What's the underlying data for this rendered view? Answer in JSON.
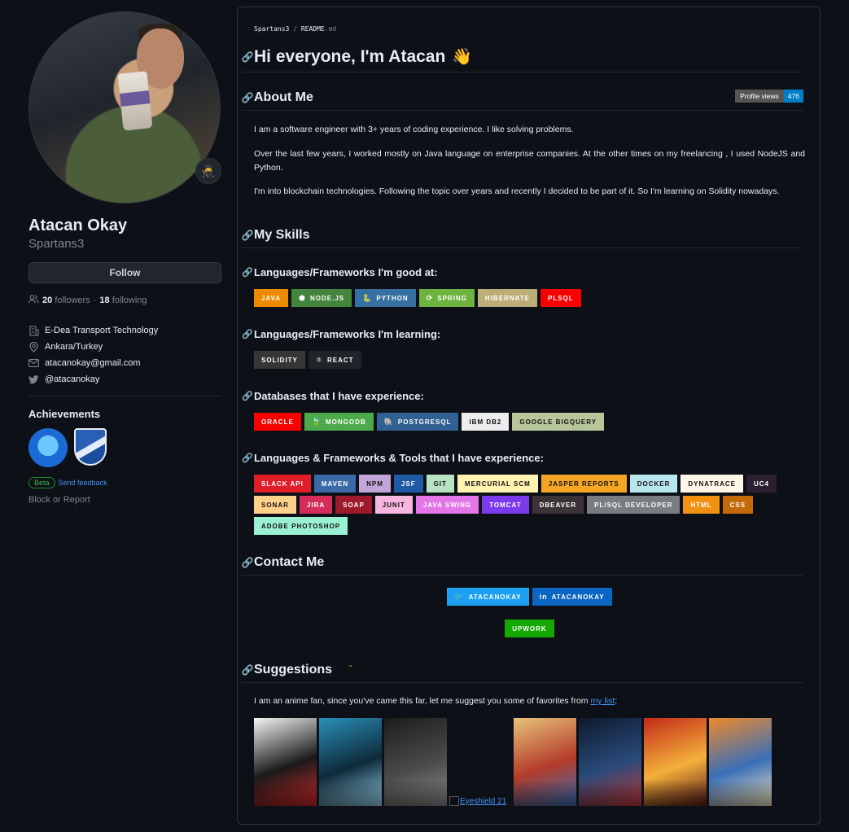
{
  "profile": {
    "fullname": "Atacan Okay",
    "username": "Spartans3",
    "follow_label": "Follow",
    "followers_count": "20",
    "followers_label": "followers",
    "following_count": "18",
    "following_label": "following",
    "separator": "·",
    "company": "E-Dea Transport Technology",
    "location": "Ankara/Turkey",
    "email": "atacanokay@gmail.com",
    "twitter": "@atacanokay",
    "achievements_title": "Achievements",
    "beta_label": "Beta",
    "feedback_label": "Send feedback",
    "block_label": "Block or Report"
  },
  "readme": {
    "breadcrumb_user": "Spartans3",
    "breadcrumb_sep": "/",
    "breadcrumb_file": "README",
    "breadcrumb_ext": ".md",
    "title": "Hi everyone, I'm Atacan",
    "wave": "👋",
    "about_heading": "About Me",
    "profile_views_label": "Profile views",
    "profile_views_count": "476",
    "about_p1": "I am a software engineer with 3+ years of coding experience. I like solving problems.",
    "about_p2": "Over the last few years, I worked mostly on Java language on enterprise companies. At the other times on my freelancing , I used NodeJS and Python.",
    "about_p3": "I'm into blockchain technologies. Following the topic over years and recently I decided to be part of it. So I'm learning on Solidity nowadays.",
    "skills_heading": "My Skills",
    "good_heading": "Languages/Frameworks I'm good at:",
    "learning_heading": "Languages/Frameworks I'm learning:",
    "db_heading": "Databases that I have experience:",
    "tools_heading": "Languages & Frameworks & Tools that I have experience:",
    "contact_heading": "Contact Me",
    "suggestions_heading": "Suggestions",
    "suggestions_text": "I am an anime fan, since you've came this far, let me suggest you some of favorites from",
    "suggestions_link": "my list",
    "suggestions_end": ":",
    "broken_image_alt": "Eyeshield 21"
  },
  "badges": {
    "good": [
      {
        "label": "JAVA",
        "color": "#ED8B00",
        "icon": ""
      },
      {
        "label": "NODE.JS",
        "color": "#43853D",
        "icon": "⬢"
      },
      {
        "label": "PYTHON",
        "color": "#3670A0",
        "icon": "🐍"
      },
      {
        "label": "SPRING",
        "color": "#6DB33F",
        "icon": "⟳"
      },
      {
        "label": "HIBERNATE",
        "color": "#BCAE79",
        "icon": ""
      },
      {
        "label": "PLSQL",
        "color": "#F80000",
        "icon": ""
      }
    ],
    "learning": [
      {
        "label": "SOLIDITY",
        "color": "#363636",
        "icon": ""
      },
      {
        "label": "REACT",
        "color": "#20232A",
        "icon": "⚛"
      }
    ],
    "db": [
      {
        "label": "ORACLE",
        "color": "#F80000",
        "icon": ""
      },
      {
        "label": "MONGODB",
        "color": "#4EA94B",
        "icon": "🍃"
      },
      {
        "label": "POSTGRESQL",
        "color": "#316192",
        "icon": "🐘"
      },
      {
        "label": "IBM DB2",
        "color": "#EDEDED",
        "icon": "",
        "dark": true
      },
      {
        "label": "GOOGLE BIGQUERY",
        "color": "#B8C79A",
        "icon": "",
        "dark": true
      }
    ],
    "tools": [
      {
        "label": "SLACK API",
        "color": "#E01E2A",
        "icon": ""
      },
      {
        "label": "MAVEN",
        "color": "#3A6BA8",
        "icon": ""
      },
      {
        "label": "NPM",
        "color": "#C3A6D9",
        "icon": "",
        "dark": true
      },
      {
        "label": "JSF",
        "color": "#1F5AA6",
        "icon": ""
      },
      {
        "label": "GIT",
        "color": "#B7E3C3",
        "icon": "",
        "dark": true
      },
      {
        "label": "MERCURIAL SCM",
        "color": "#FFF3B0",
        "icon": "",
        "dark": true
      },
      {
        "label": "JASPER REPORTS",
        "color": "#F5A524",
        "icon": "",
        "dark": true
      },
      {
        "label": "DOCKER",
        "color": "#B8E6EE",
        "icon": "",
        "dark": true
      },
      {
        "label": "DYNATRACE",
        "color": "#FFF6E8",
        "icon": "",
        "dark": true
      },
      {
        "label": "UC4",
        "color": "#2A2032",
        "icon": ""
      },
      {
        "label": "SONAR",
        "color": "#FFD08A",
        "icon": "",
        "dark": true
      },
      {
        "label": "JIRA",
        "color": "#D62C5A",
        "icon": ""
      },
      {
        "label": "SOAP",
        "color": "#9C1A2C",
        "icon": ""
      },
      {
        "label": "JUNIT",
        "color": "#F6B6E0",
        "icon": "",
        "dark": true
      },
      {
        "label": "JAVA SWING",
        "color": "#E377E8",
        "icon": ""
      },
      {
        "label": "TOMCAT",
        "color": "#7C3AED",
        "icon": ""
      },
      {
        "label": "DBEAVER",
        "color": "#3B3338",
        "icon": ""
      },
      {
        "label": "PL/SQL DEVELOPER",
        "color": "#7A7D80",
        "icon": ""
      },
      {
        "label": "HTML",
        "color": "#F29111",
        "icon": ""
      },
      {
        "label": "CSS",
        "color": "#C56A0A",
        "icon": ""
      },
      {
        "label": "ADOBE PHOTOSHOP",
        "color": "#9AF0D2",
        "icon": "",
        "dark": true
      }
    ],
    "contact": [
      {
        "label": "ATACANOKAY",
        "color": "#1CA1F2",
        "icon": "🐦"
      },
      {
        "label": "ATACANOKAY",
        "color": "#0A66C2",
        "icon": "in"
      }
    ],
    "contact2": [
      {
        "label": "UPWORK",
        "color": "#14A800",
        "icon": ""
      }
    ]
  },
  "thumbnails": [
    {
      "name": "bleach-thumb",
      "colors": [
        "#f5f5f5",
        "#1a1a1a",
        "#d42a2a"
      ]
    },
    {
      "name": "attack-on-titan-thumb",
      "colors": [
        "#2a8fb8",
        "#0e2a3a",
        "#9ad6ef"
      ]
    },
    {
      "name": "death-note-thumb",
      "colors": [
        "#1c1c1c",
        "#4a4a4a",
        "#8a8a8a"
      ]
    },
    {
      "name": "fairy-tail-thumb",
      "colors": [
        "#e8c37a",
        "#b33b2a",
        "#3b6fb5"
      ]
    },
    {
      "name": "demon-slayer-thumb",
      "colors": [
        "#0e1a2e",
        "#2a4a7a",
        "#c43a3a"
      ]
    },
    {
      "name": "seven-deadly-sins-thumb",
      "colors": [
        "#c42a1a",
        "#f3b03a",
        "#5a1a1a"
      ]
    },
    {
      "name": "naruto-thumb",
      "colors": [
        "#f08a2a",
        "#3a6fb8",
        "#f5e6c0"
      ]
    }
  ]
}
